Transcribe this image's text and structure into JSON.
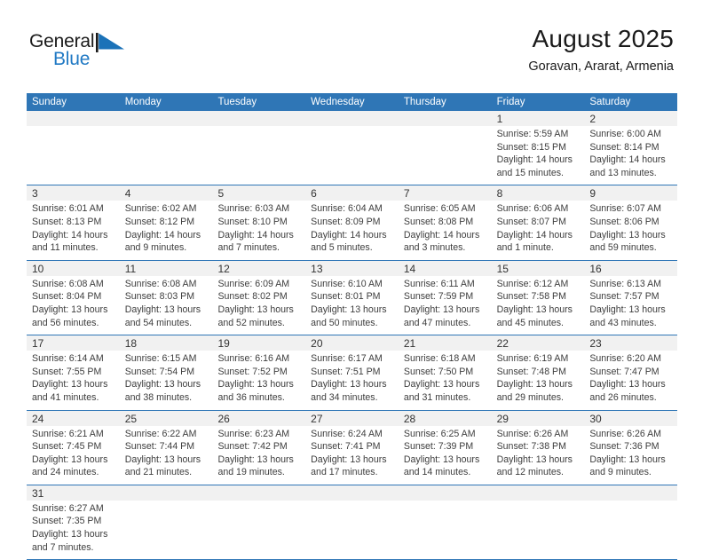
{
  "brand": {
    "name_part1": "General",
    "name_part2": "Blue",
    "flag_icon": "blue-triangle-flag-icon",
    "primary_color": "#2079c4"
  },
  "header": {
    "title": "August 2025",
    "subtitle": "Goravan, Ararat, Armenia"
  },
  "theme": {
    "header_blue": "#2f76b6",
    "row_divider": "#2f76b6",
    "day_band_gray": "#f1f1f1"
  },
  "calendar": {
    "weekday_headers": [
      "Sunday",
      "Monday",
      "Tuesday",
      "Wednesday",
      "Thursday",
      "Friday",
      "Saturday"
    ],
    "weeks": [
      [
        {
          "day": "",
          "lines": []
        },
        {
          "day": "",
          "lines": []
        },
        {
          "day": "",
          "lines": []
        },
        {
          "day": "",
          "lines": []
        },
        {
          "day": "",
          "lines": []
        },
        {
          "day": "1",
          "lines": [
            "Sunrise: 5:59 AM",
            "Sunset: 8:15 PM",
            "Daylight: 14 hours",
            "and 15 minutes."
          ]
        },
        {
          "day": "2",
          "lines": [
            "Sunrise: 6:00 AM",
            "Sunset: 8:14 PM",
            "Daylight: 14 hours",
            "and 13 minutes."
          ]
        }
      ],
      [
        {
          "day": "3",
          "lines": [
            "Sunrise: 6:01 AM",
            "Sunset: 8:13 PM",
            "Daylight: 14 hours",
            "and 11 minutes."
          ]
        },
        {
          "day": "4",
          "lines": [
            "Sunrise: 6:02 AM",
            "Sunset: 8:12 PM",
            "Daylight: 14 hours",
            "and 9 minutes."
          ]
        },
        {
          "day": "5",
          "lines": [
            "Sunrise: 6:03 AM",
            "Sunset: 8:10 PM",
            "Daylight: 14 hours",
            "and 7 minutes."
          ]
        },
        {
          "day": "6",
          "lines": [
            "Sunrise: 6:04 AM",
            "Sunset: 8:09 PM",
            "Daylight: 14 hours",
            "and 5 minutes."
          ]
        },
        {
          "day": "7",
          "lines": [
            "Sunrise: 6:05 AM",
            "Sunset: 8:08 PM",
            "Daylight: 14 hours",
            "and 3 minutes."
          ]
        },
        {
          "day": "8",
          "lines": [
            "Sunrise: 6:06 AM",
            "Sunset: 8:07 PM",
            "Daylight: 14 hours",
            "and 1 minute."
          ]
        },
        {
          "day": "9",
          "lines": [
            "Sunrise: 6:07 AM",
            "Sunset: 8:06 PM",
            "Daylight: 13 hours",
            "and 59 minutes."
          ]
        }
      ],
      [
        {
          "day": "10",
          "lines": [
            "Sunrise: 6:08 AM",
            "Sunset: 8:04 PM",
            "Daylight: 13 hours",
            "and 56 minutes."
          ]
        },
        {
          "day": "11",
          "lines": [
            "Sunrise: 6:08 AM",
            "Sunset: 8:03 PM",
            "Daylight: 13 hours",
            "and 54 minutes."
          ]
        },
        {
          "day": "12",
          "lines": [
            "Sunrise: 6:09 AM",
            "Sunset: 8:02 PM",
            "Daylight: 13 hours",
            "and 52 minutes."
          ]
        },
        {
          "day": "13",
          "lines": [
            "Sunrise: 6:10 AM",
            "Sunset: 8:01 PM",
            "Daylight: 13 hours",
            "and 50 minutes."
          ]
        },
        {
          "day": "14",
          "lines": [
            "Sunrise: 6:11 AM",
            "Sunset: 7:59 PM",
            "Daylight: 13 hours",
            "and 47 minutes."
          ]
        },
        {
          "day": "15",
          "lines": [
            "Sunrise: 6:12 AM",
            "Sunset: 7:58 PM",
            "Daylight: 13 hours",
            "and 45 minutes."
          ]
        },
        {
          "day": "16",
          "lines": [
            "Sunrise: 6:13 AM",
            "Sunset: 7:57 PM",
            "Daylight: 13 hours",
            "and 43 minutes."
          ]
        }
      ],
      [
        {
          "day": "17",
          "lines": [
            "Sunrise: 6:14 AM",
            "Sunset: 7:55 PM",
            "Daylight: 13 hours",
            "and 41 minutes."
          ]
        },
        {
          "day": "18",
          "lines": [
            "Sunrise: 6:15 AM",
            "Sunset: 7:54 PM",
            "Daylight: 13 hours",
            "and 38 minutes."
          ]
        },
        {
          "day": "19",
          "lines": [
            "Sunrise: 6:16 AM",
            "Sunset: 7:52 PM",
            "Daylight: 13 hours",
            "and 36 minutes."
          ]
        },
        {
          "day": "20",
          "lines": [
            "Sunrise: 6:17 AM",
            "Sunset: 7:51 PM",
            "Daylight: 13 hours",
            "and 34 minutes."
          ]
        },
        {
          "day": "21",
          "lines": [
            "Sunrise: 6:18 AM",
            "Sunset: 7:50 PM",
            "Daylight: 13 hours",
            "and 31 minutes."
          ]
        },
        {
          "day": "22",
          "lines": [
            "Sunrise: 6:19 AM",
            "Sunset: 7:48 PM",
            "Daylight: 13 hours",
            "and 29 minutes."
          ]
        },
        {
          "day": "23",
          "lines": [
            "Sunrise: 6:20 AM",
            "Sunset: 7:47 PM",
            "Daylight: 13 hours",
            "and 26 minutes."
          ]
        }
      ],
      [
        {
          "day": "24",
          "lines": [
            "Sunrise: 6:21 AM",
            "Sunset: 7:45 PM",
            "Daylight: 13 hours",
            "and 24 minutes."
          ]
        },
        {
          "day": "25",
          "lines": [
            "Sunrise: 6:22 AM",
            "Sunset: 7:44 PM",
            "Daylight: 13 hours",
            "and 21 minutes."
          ]
        },
        {
          "day": "26",
          "lines": [
            "Sunrise: 6:23 AM",
            "Sunset: 7:42 PM",
            "Daylight: 13 hours",
            "and 19 minutes."
          ]
        },
        {
          "day": "27",
          "lines": [
            "Sunrise: 6:24 AM",
            "Sunset: 7:41 PM",
            "Daylight: 13 hours",
            "and 17 minutes."
          ]
        },
        {
          "day": "28",
          "lines": [
            "Sunrise: 6:25 AM",
            "Sunset: 7:39 PM",
            "Daylight: 13 hours",
            "and 14 minutes."
          ]
        },
        {
          "day": "29",
          "lines": [
            "Sunrise: 6:26 AM",
            "Sunset: 7:38 PM",
            "Daylight: 13 hours",
            "and 12 minutes."
          ]
        },
        {
          "day": "30",
          "lines": [
            "Sunrise: 6:26 AM",
            "Sunset: 7:36 PM",
            "Daylight: 13 hours",
            "and 9 minutes."
          ]
        }
      ],
      [
        {
          "day": "31",
          "lines": [
            "Sunrise: 6:27 AM",
            "Sunset: 7:35 PM",
            "Daylight: 13 hours",
            "and 7 minutes."
          ]
        },
        {
          "day": "",
          "lines": []
        },
        {
          "day": "",
          "lines": []
        },
        {
          "day": "",
          "lines": []
        },
        {
          "day": "",
          "lines": []
        },
        {
          "day": "",
          "lines": []
        },
        {
          "day": "",
          "lines": []
        }
      ]
    ]
  }
}
